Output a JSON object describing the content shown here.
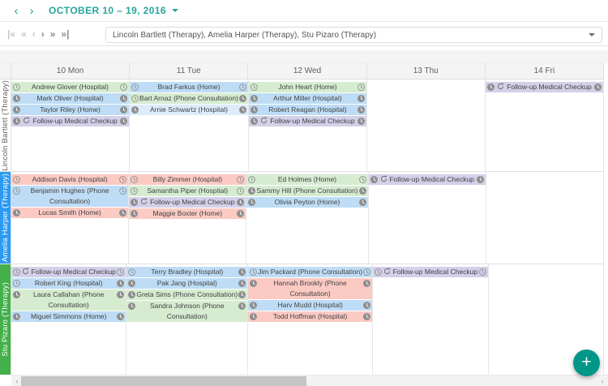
{
  "topbar": {
    "title": "OCTOBER 10 – 19, 2016",
    "prev_icon": "‹",
    "next_icon": "›"
  },
  "pager": {
    "items": [
      {
        "name": "first",
        "glyph": "|«",
        "enabled": false
      },
      {
        "name": "prev-chunk",
        "glyph": "«",
        "enabled": false
      },
      {
        "name": "prev",
        "glyph": "‹",
        "enabled": false
      },
      {
        "name": "next",
        "glyph": "›",
        "enabled": true
      },
      {
        "name": "next-chunk",
        "glyph": "»",
        "enabled": true
      },
      {
        "name": "last",
        "glyph": "»|",
        "enabled": true
      }
    ]
  },
  "resource_filter": {
    "value": "Lincoln Bartlett (Therapy), Amelia Harper (Therapy), Stu Pizaro (Therapy)"
  },
  "fab": {
    "label": "+"
  },
  "scrollbar": {
    "left_arrow": "‹",
    "right_arrow": "›"
  },
  "palette": {
    "accent": "#26a69a",
    "fab": "#009688",
    "resource_blue": "#2b9af3",
    "resource_green": "#43b04a",
    "event_colors": {
      "green": "#d5ecd0",
      "blue": "#bedcf5",
      "blue_light": "#ddecfb",
      "pink": "#fbcac3",
      "purple": "#d3d0e9"
    }
  },
  "scheduler": {
    "days": [
      "10 Mon",
      "11 Tue",
      "12 Wed",
      "13 Thu",
      "14 Fri"
    ],
    "resources": [
      {
        "name": "Lincoln Bartlett (Therapy)",
        "label_bg": "#ffffff",
        "label_fg": "#616161",
        "events": [
          [
            {
              "title": "Andrew Glover (Hospital)",
              "color": "green",
              "left_icon": "clock-outline",
              "right_icon": "clock-outline"
            },
            {
              "title": "Mark Oliver (Hospital)",
              "color": "blue",
              "left_icon": "clock-filled",
              "right_icon": "clock-filled"
            },
            {
              "title": "Taylor Riley (Home)",
              "color": "blue",
              "left_icon": "clock-filled",
              "right_icon": "clock-filled"
            },
            {
              "title": "Follow-up Medical Checkup",
              "color": "purple",
              "left_icon": "clock-filled",
              "right_icon": "clock-filled",
              "recurring": true
            }
          ],
          [
            {
              "title": "Brad Farkus (Home)",
              "color": "blue",
              "left_icon": "clock-outline",
              "right_icon": "clock-outline"
            },
            {
              "title": "Bart Arnaz (Phone Consultation)",
              "color": "green",
              "left_icon": "clock-outline",
              "right_icon": "clock-filled"
            },
            {
              "title": "Arnie Schwartz (Hospital)",
              "color": "blue_light",
              "left_icon": "clock-filled",
              "right_icon": "clock-filled"
            }
          ],
          [
            {
              "title": "John Heart (Home)",
              "color": "green",
              "left_icon": "clock-outline",
              "right_icon": "clock-outline"
            },
            {
              "title": "Arthur Miller (Hospital)",
              "color": "blue",
              "left_icon": "clock-filled",
              "right_icon": "clock-filled"
            },
            {
              "title": "Robert Reagan (Hospital)",
              "color": "blue",
              "left_icon": "clock-filled",
              "right_icon": "clock-filled"
            },
            {
              "title": "Follow-up Medical Checkup",
              "color": "purple",
              "left_icon": "clock-filled",
              "right_icon": "clock-filled",
              "recurring": true
            }
          ],
          [],
          [
            {
              "title": "Follow-up Medical Checkup",
              "color": "purple",
              "left_icon": "clock-filled",
              "right_icon": "clock-filled",
              "recurring": true
            }
          ]
        ]
      },
      {
        "name": "Amelia Harper (Therapy)",
        "label_bg": "#2b9af3",
        "label_fg": "#ffffff",
        "events": [
          [
            {
              "title": "Addison Davis (Hospital)",
              "color": "pink",
              "left_icon": "clock-outline",
              "right_icon": "clock-outline"
            },
            {
              "title": "Benjamin Hughes (Phone Consultation)",
              "color": "blue",
              "left_icon": "clock-outline",
              "right_icon": "clock-outline",
              "two": true
            },
            {
              "title": "Lucas Smith (Home)",
              "color": "pink",
              "left_icon": "clock-filled",
              "right_icon": "clock-filled"
            }
          ],
          [
            {
              "title": "Billy Zimmer (Hospital)",
              "color": "pink",
              "left_icon": "clock-outline",
              "right_icon": "clock-outline"
            },
            {
              "title": "Samantha Piper (Hospital)",
              "color": "green",
              "left_icon": "clock-outline",
              "right_icon": "clock-outline"
            },
            {
              "title": "Follow-up Medical Checkup",
              "color": "purple",
              "left_icon": "clock-filled",
              "right_icon": "clock-filled",
              "recurring": true
            },
            {
              "title": "Maggie Boxter (Home)",
              "color": "pink",
              "left_icon": "clock-filled",
              "right_icon": "clock-filled"
            }
          ],
          [
            {
              "title": "Ed Holmes (Home)",
              "color": "green",
              "left_icon": "clock-outline",
              "right_icon": "clock-outline"
            },
            {
              "title": "Sammy Hill (Phone Consultation)",
              "color": "green",
              "left_icon": "clock-filled",
              "right_icon": "clock-filled"
            },
            {
              "title": "Olivia Peyton (Home)",
              "color": "blue",
              "left_icon": "clock-filled",
              "right_icon": "clock-filled"
            }
          ],
          [
            {
              "title": "Follow-up Medical Checkup",
              "color": "purple",
              "left_icon": "clock-filled",
              "right_icon": "clock-filled",
              "recurring": true
            }
          ],
          []
        ]
      },
      {
        "name": "Stu Pizaro (Therapy)",
        "label_bg": "#43b04a",
        "label_fg": "#ffffff",
        "events": [
          [
            {
              "title": "Follow-up Medical Checkup",
              "color": "purple",
              "left_icon": "clock-outline",
              "right_icon": "clock-outline",
              "recurring": true
            },
            {
              "title": "Robert King (Hospital)",
              "color": "blue",
              "left_icon": "clock-outline",
              "right_icon": "clock-filled"
            },
            {
              "title": "Laura Callahan (Phone Consultation)",
              "color": "green",
              "left_icon": "clock-filled",
              "right_icon": "clock-filled",
              "two": true
            },
            {
              "title": "Miguel Simmons (Home)",
              "color": "blue",
              "left_icon": "clock-filled",
              "right_icon": "clock-filled"
            }
          ],
          [
            {
              "title": "Terry Bradley (Hospital)",
              "color": "blue",
              "left_icon": "clock-outline",
              "right_icon": "clock-filled"
            },
            {
              "title": "Pak Jang (Hospital)",
              "color": "blue",
              "left_icon": "clock-filled",
              "right_icon": "clock-filled"
            },
            {
              "title": "Greta Sims (Phone Consultation)",
              "color": "green",
              "left_icon": "clock-filled",
              "right_icon": "clock-filled"
            },
            {
              "title": "Sandra Johnson (Phone Consultation)",
              "color": "green",
              "left_icon": "clock-filled",
              "right_icon": "clock-filled",
              "two": true
            }
          ],
          [
            {
              "title": "Jim Packard (Phone Consultation)",
              "color": "blue",
              "left_icon": "clock-outline",
              "right_icon": "clock-outline"
            },
            {
              "title": "Hannah Brookly (Phone Consultation)",
              "color": "pink",
              "left_icon": "clock-filled",
              "right_icon": "clock-filled",
              "two": true
            },
            {
              "title": "Harv Mudd (Hospital)",
              "color": "blue",
              "left_icon": "clock-filled",
              "right_icon": "clock-filled"
            },
            {
              "title": "Todd Hoffman (Hospital)",
              "color": "pink",
              "left_icon": "clock-filled",
              "right_icon": "clock-filled"
            }
          ],
          [
            {
              "title": "Follow-up Medical Checkup",
              "color": "purple",
              "left_icon": "clock-outline",
              "right_icon": "clock-outline",
              "recurring": true
            }
          ],
          []
        ]
      }
    ]
  }
}
